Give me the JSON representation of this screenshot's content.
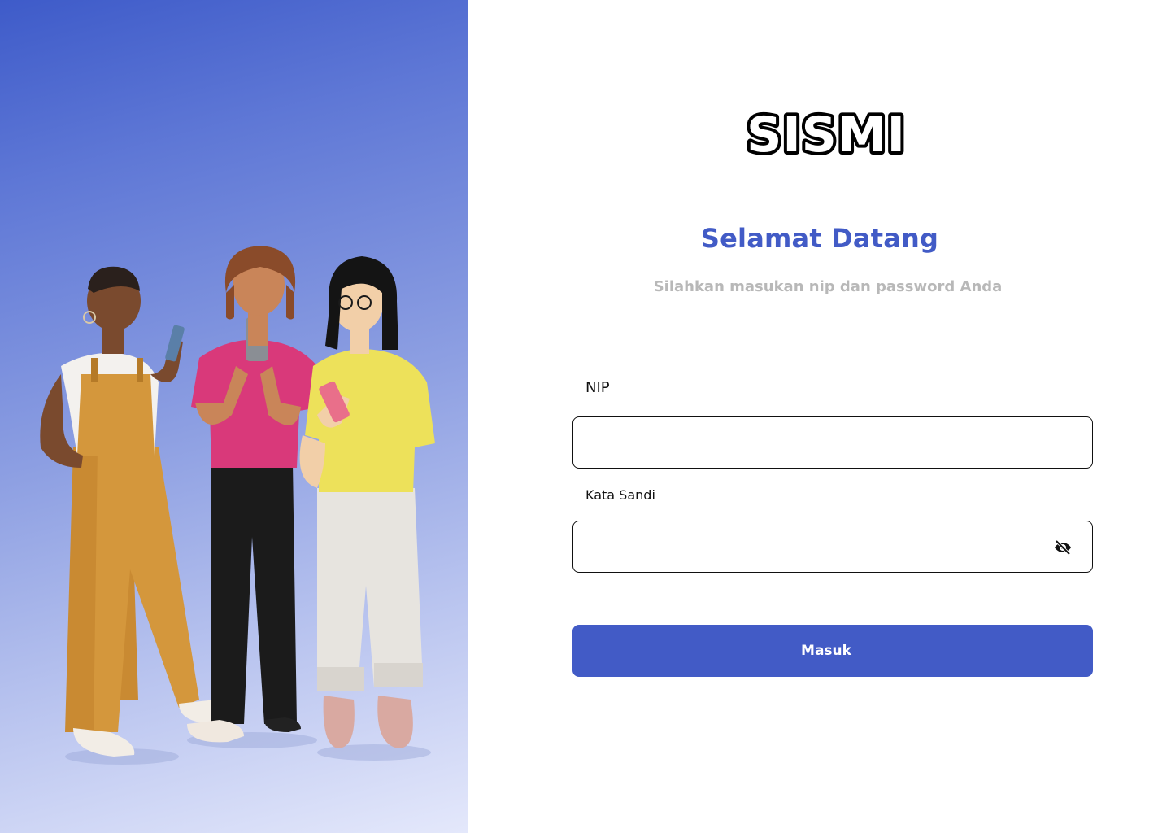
{
  "brand": {
    "logo_text": "SISMI"
  },
  "welcome": {
    "title": "Selamat Datang",
    "subtitle": "Silahkan masukan nip dan password Anda"
  },
  "form": {
    "nip_label": "NIP",
    "nip_value": "",
    "password_label": "Kata Sandi",
    "password_value": "",
    "password_toggle_icon": "eye-off-icon",
    "submit_label": "Masuk"
  },
  "colors": {
    "primary": "#425bc6",
    "subtitle": "#b8b8b8",
    "panel_gradient_top": "#3e5bc9",
    "panel_gradient_bottom": "#e4e8fb"
  }
}
